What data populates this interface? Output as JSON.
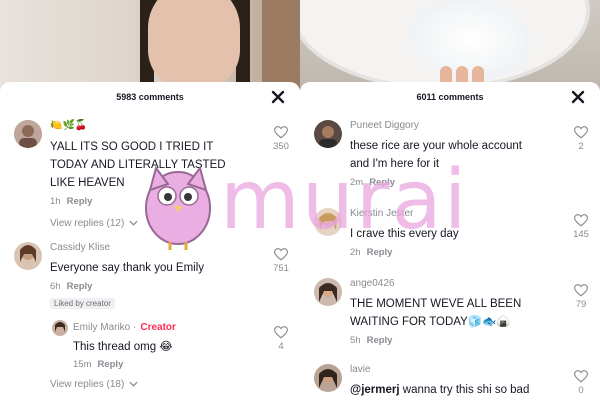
{
  "left_panel": {
    "title": "5983 comments",
    "comments": [
      {
        "emoji_username": "🍋🌿🍒",
        "text_lines": [
          "YALL ITS SO GOOD I TRIED IT",
          "TODAY AND LITERALLY TASTED",
          "LIKE HEAVEN"
        ],
        "time": "1h",
        "reply_label": "Reply",
        "likes": "350",
        "view_replies": "View replies (12)"
      },
      {
        "username": "Cassidy Klise",
        "text": "Everyone say thank you Emily",
        "time": "6h",
        "reply_label": "Reply",
        "likes": "751",
        "badge": "Liked by creator",
        "reply": {
          "username": "Emily Mariko",
          "creator_label": "Creator",
          "text": "This thread omg 😂",
          "time": "15m",
          "reply_label": "Reply",
          "likes": "4"
        },
        "view_replies": "View replies (18)"
      }
    ]
  },
  "right_panel": {
    "title": "6011 comments",
    "comments": [
      {
        "username": "Puneet Diggory",
        "text_lines": [
          "these rice are your whole account",
          "and I'm here for it"
        ],
        "time": "2m",
        "reply_label": "Reply",
        "likes": "2"
      },
      {
        "username": "Kierstin Jester",
        "text": "I crave this every day",
        "time": "2h",
        "reply_label": "Reply",
        "likes": "145"
      },
      {
        "username": "ange0426",
        "text_lines": [
          "THE MOMENT WEVE ALL BEEN",
          "WAITING FOR TODAY🧊🐟🍙"
        ],
        "time": "5h",
        "reply_label": "Reply",
        "likes": "79"
      },
      {
        "username": "lavie",
        "mention": "@jermerj",
        "text": " wanna try this shi so bad",
        "likes": "0"
      }
    ]
  },
  "watermark": {
    "text": "murai"
  },
  "colors": {
    "creator": "#fe2c55",
    "muted": "#8a8b91",
    "watermark": "#e9a6e0"
  }
}
